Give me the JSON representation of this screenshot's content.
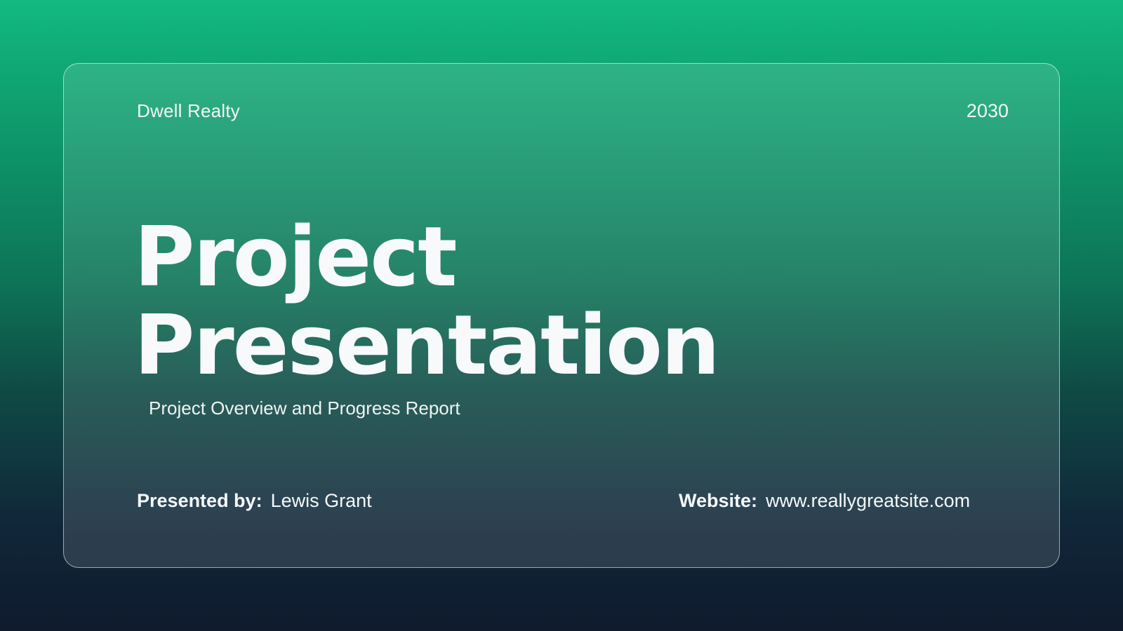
{
  "header": {
    "brand": "Dwell Realty",
    "year": "2030"
  },
  "main": {
    "title_line1": "Project",
    "title_line2": "Presentation",
    "subtitle": "Project Overview and Progress Report"
  },
  "footer": {
    "presenter_label": "Presented by:",
    "presenter_name": "Lewis Grant",
    "website_label": "Website:",
    "website_url": "www.reallygreatsite.com"
  },
  "colors": {
    "bg_top": "#12b981",
    "bg_bottom": "#0f1a2d",
    "text": "#f7f9fb"
  }
}
